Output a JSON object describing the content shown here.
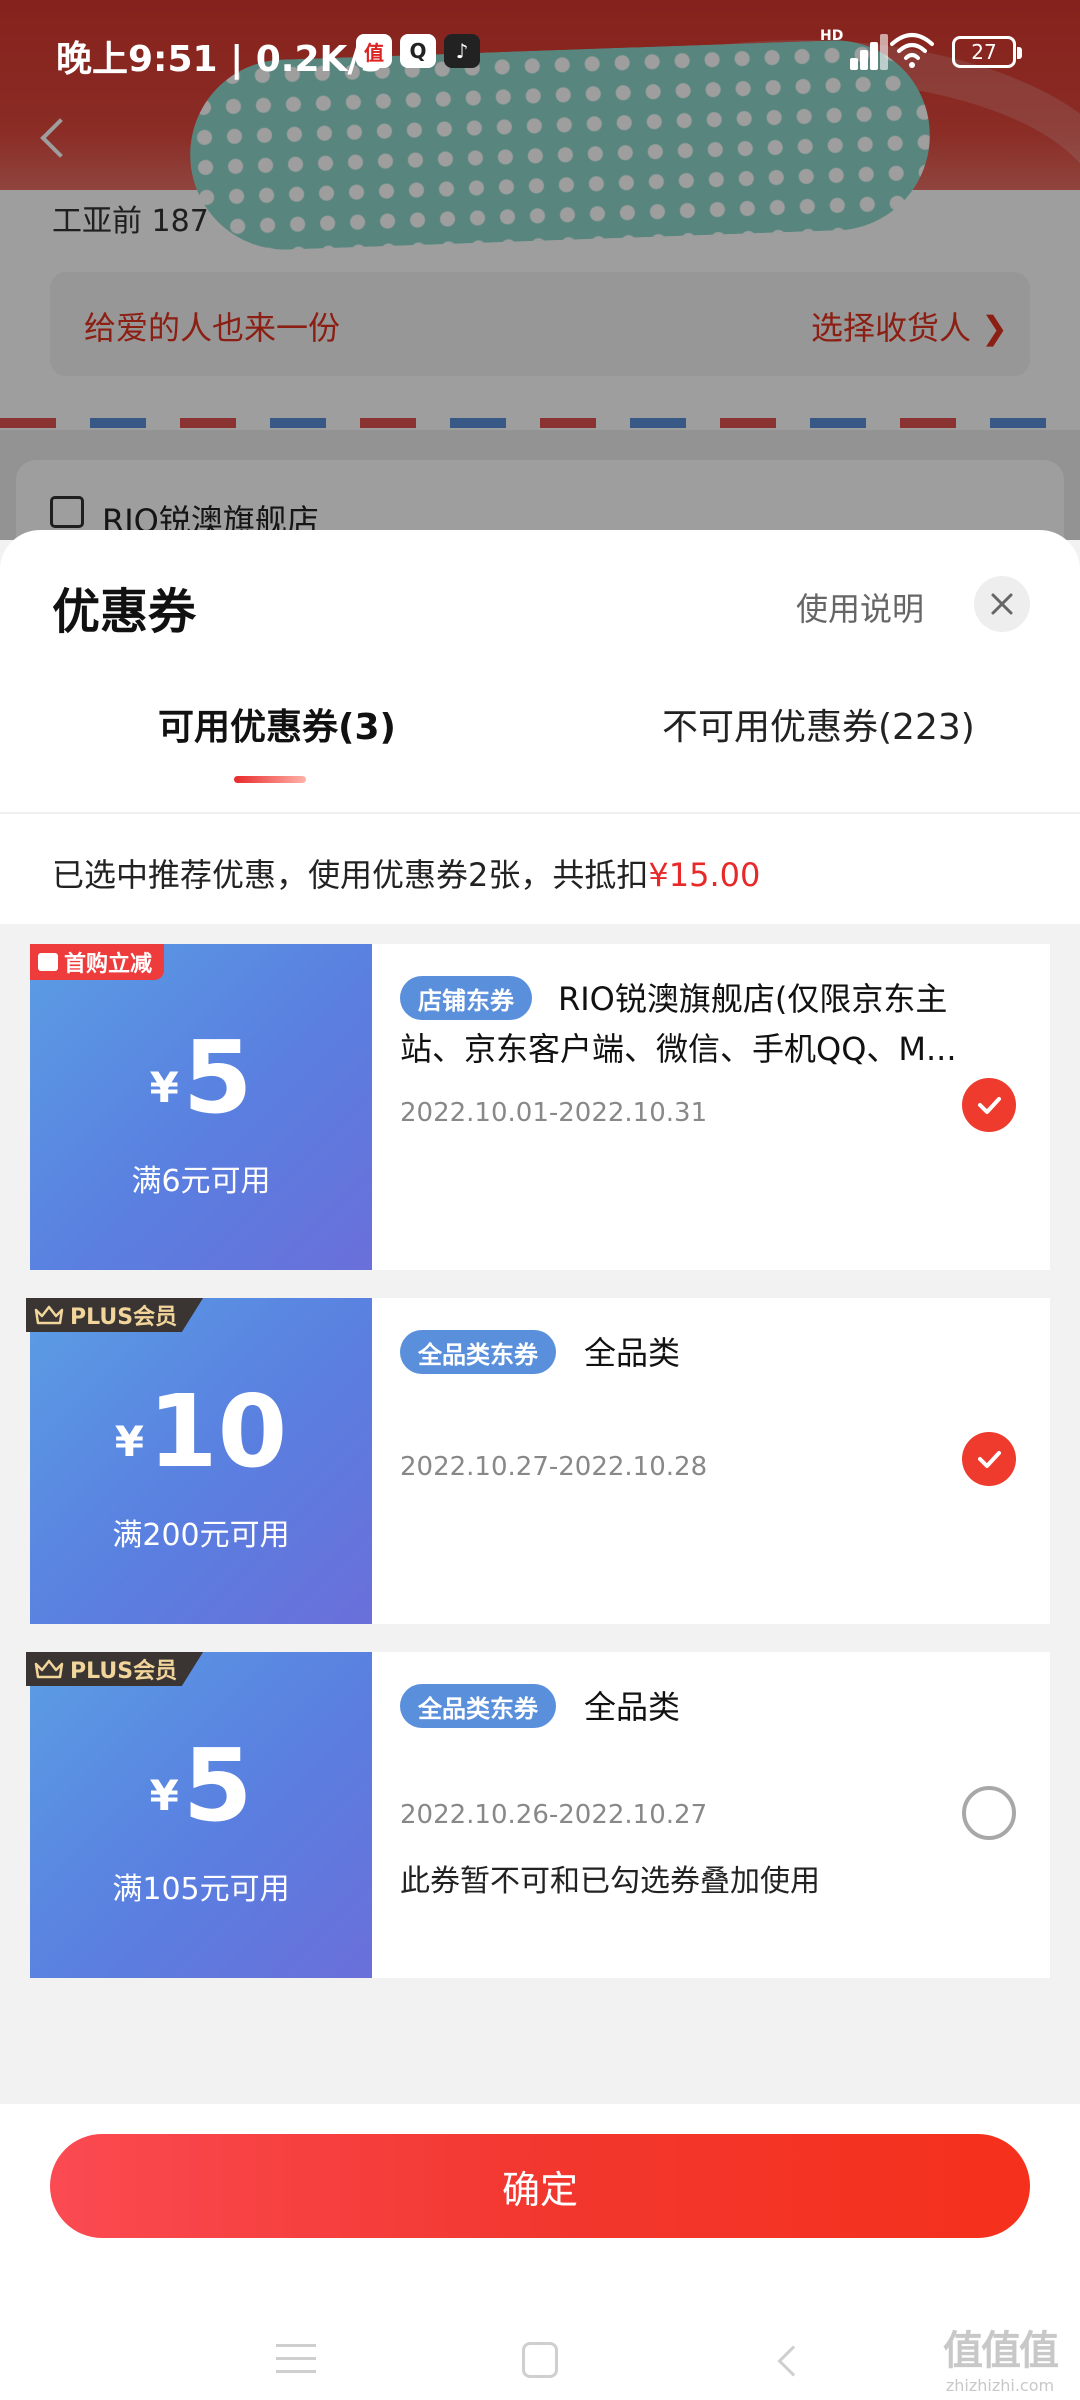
{
  "status_bar": {
    "time": "晚上9:51 | 0.2K/s",
    "app_icons": [
      "值",
      "Q",
      "♪"
    ],
    "hd": "HD",
    "battery": "27"
  },
  "background": {
    "partial_text": "工亚前 187",
    "gift_text": "给爱的人也来一份",
    "gift_link": "选择收货人 ❯",
    "store_name": "RIO锐澳旗舰店"
  },
  "sheet": {
    "title": "优惠券",
    "help_label": "使用说明",
    "tabs": [
      {
        "label": "可用优惠券(3)",
        "active": true
      },
      {
        "label": "不可用优惠券(223)",
        "active": false
      }
    ],
    "summary_prefix": "已选中推荐优惠，使用优惠券2张，共抵扣",
    "summary_amount": "¥15.00",
    "confirm_label": "确定"
  },
  "coupons": [
    {
      "badge": "首购立减",
      "badge_type": "first-purchase",
      "currency": "¥",
      "amount": "5",
      "condition": "满6元可用",
      "tag": "店铺东券",
      "name_line1": "RIO锐澳旗舰店(仅限京东主",
      "name_line2": "站、京东客户端、微信、手机QQ、M...",
      "date": "2022.10.01-2022.10.31",
      "note": "",
      "selected": true
    },
    {
      "badge": "PLUS会员",
      "badge_type": "plus",
      "currency": "¥",
      "amount": "10",
      "condition": "满200元可用",
      "tag": "全品类东券",
      "name_line1": "全品类",
      "name_line2": "",
      "date": "2022.10.27-2022.10.28",
      "note": "",
      "selected": true
    },
    {
      "badge": "PLUS会员",
      "badge_type": "plus",
      "currency": "¥",
      "amount": "5",
      "condition": "满105元可用",
      "tag": "全品类东券",
      "name_line1": "全品类",
      "name_line2": "",
      "date": "2022.10.26-2022.10.27",
      "note": "此券暂不可和已勾选券叠加使用",
      "selected": false
    }
  ],
  "watermark": {
    "logo": "值值值",
    "site": "zhizhizhi.com"
  },
  "colors": {
    "accent": "#e8292a",
    "coupon_blue": "#5a8fdc",
    "plus_gold": "#f1d59a"
  }
}
